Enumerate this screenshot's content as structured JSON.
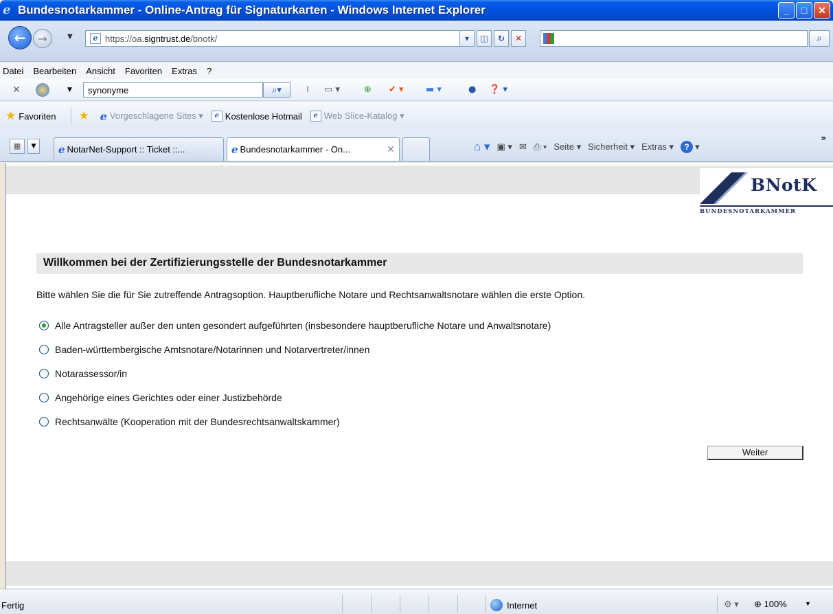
{
  "window": {
    "title": "Bundesnotarkammer - Online-Antrag für Signaturkarten - Windows Internet Explorer",
    "app_icon": "ie-logo-icon"
  },
  "address_bar": {
    "url_prefix": "https://oa.",
    "url_domain": "signtrust.de",
    "url_path": "/bnotk/"
  },
  "menu": [
    "Datei",
    "Bearbeiten",
    "Ansicht",
    "Favoriten",
    "Extras",
    "?"
  ],
  "google_toolbar": {
    "search_value": "synonyme"
  },
  "favorites_bar": {
    "favorites_label": "Favoriten",
    "items": [
      {
        "label": "Vorgeschlagene Sites ▾",
        "dim": true
      },
      {
        "label": "Kostenlose Hotmail",
        "dim": false
      },
      {
        "label": "Web Slice-Katalog ▾",
        "dim": true
      }
    ]
  },
  "tabs": [
    {
      "label": "NotarNet-Support :: Ticket ::...",
      "active": false
    },
    {
      "label": "Bundesnotarkammer - On...",
      "active": true
    }
  ],
  "command_bar": {
    "seite": "Seite ▾",
    "sicherheit": "Sicherheit ▾",
    "extras": "Extras ▾"
  },
  "page": {
    "logo_text": "BNotK",
    "logo_subtitle": "BUNDESNOTARKAMMER",
    "welcome_heading": "Willkommen bei der Zertifizierungsstelle der Bundesnotarkammer",
    "intro_text": "Bitte wählen Sie die für Sie zutreffende Antragsoption. Hauptberufliche Notare und Rechtsanwaltsnotare wählen die erste Option.",
    "options": [
      {
        "label": "Alle Antragsteller außer den unten gesondert aufgeführten (insbesondere hauptberufliche Notare und Anwaltsnotare)",
        "checked": true
      },
      {
        "label": "Baden-württembergische Amtsnotare/Notarinnen und Notarvertreter/innen",
        "checked": false
      },
      {
        "label": "Notarassessor/in",
        "checked": false
      },
      {
        "label": "Angehörige eines Gerichtes oder einer Justizbehörde",
        "checked": false
      },
      {
        "label": "Rechtsanwälte (Kooperation mit der Bundesrechtsanwaltskammer)",
        "checked": false
      }
    ],
    "submit_label": "Weiter"
  },
  "status_bar": {
    "status_text": "Fertig",
    "zone": "Internet",
    "zoom": "100%"
  },
  "colors": {
    "titlebar": "#0052e0",
    "logo_navy": "#1f2f5c",
    "radio_checked": "#2aa02a"
  }
}
